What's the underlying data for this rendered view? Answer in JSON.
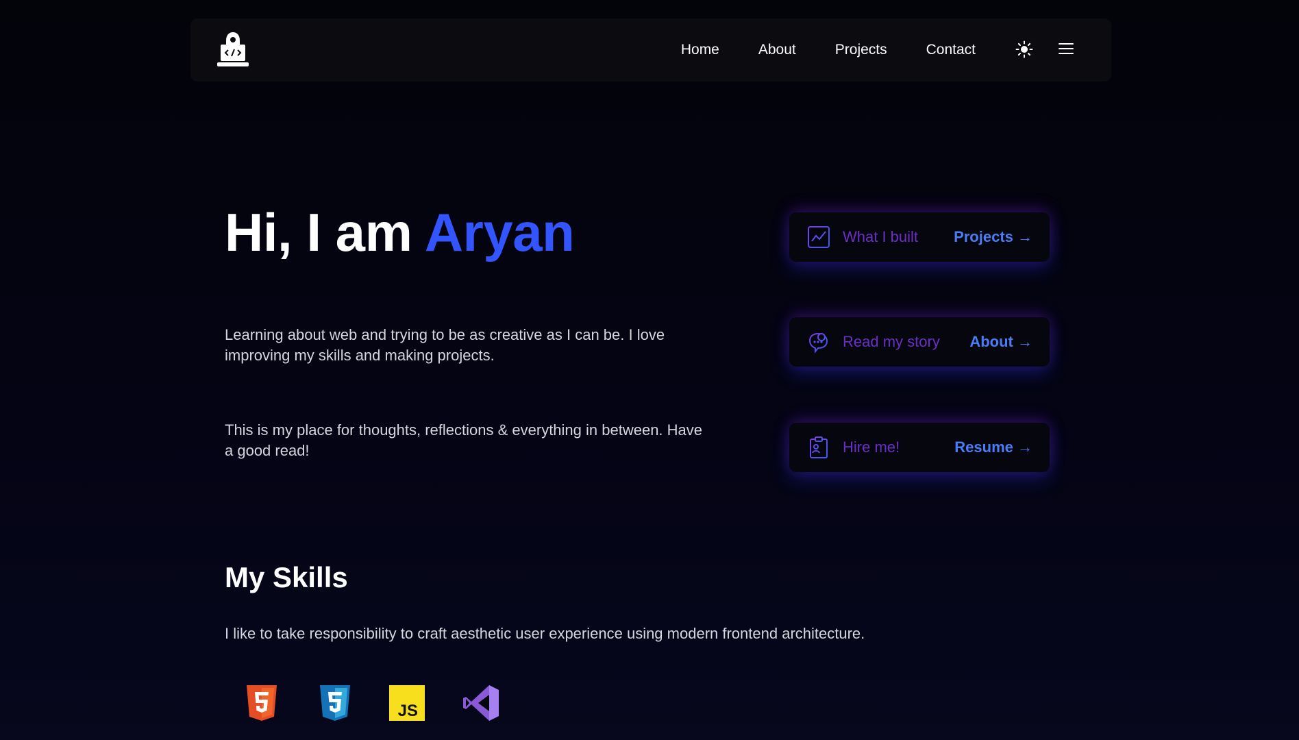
{
  "nav": {
    "logo_icon": "laptop-hacker-icon",
    "links": [
      "Home",
      "About",
      "Projects",
      "Contact"
    ],
    "theme_icon": "sun-icon",
    "menu_icon": "hamburger-menu-icon"
  },
  "hero": {
    "greeting": "Hi, I am ",
    "name": "Aryan",
    "paragraph1": "Learning about web and trying to be as creative as I can be. I love improving my skills and making projects.",
    "paragraph2": "This is my place for thoughts, reflections & everything in between. Have a good read!"
  },
  "cards": [
    {
      "icon": "chart-board-icon",
      "text": "What I built",
      "link": "Projects →"
    },
    {
      "icon": "chat-bubble-icon",
      "text": "Read my story",
      "link": "About →"
    },
    {
      "icon": "clipboard-id-icon",
      "text": "Hire me!",
      "link": "Resume →"
    }
  ],
  "skills": {
    "title": "My Skills",
    "description": "I like to take responsibility to craft aesthetic user experience using modern frontend architecture.",
    "icons": [
      "html5-icon",
      "css3-icon",
      "javascript-icon",
      "visual-studio-icon"
    ],
    "js_label": "JS"
  },
  "colors": {
    "accent": "#3355ff",
    "card_text": "#6a2fc4",
    "card_link": "#4a7cf6",
    "background": "#03030a",
    "navbar": "#0b0b10"
  }
}
